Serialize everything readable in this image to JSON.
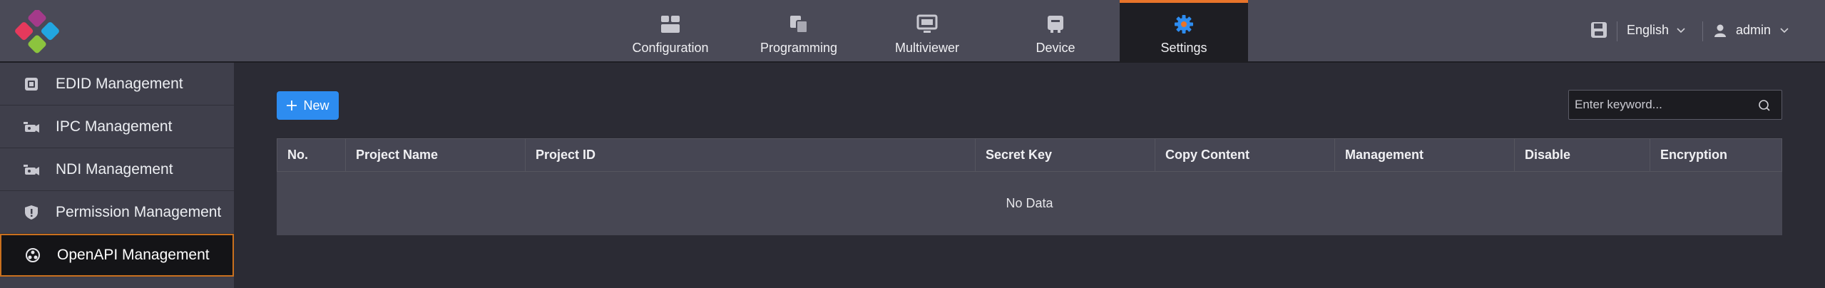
{
  "nav": {
    "tabs": [
      {
        "label": "Configuration",
        "icon": "configuration-icon"
      },
      {
        "label": "Programming",
        "icon": "programming-icon"
      },
      {
        "label": "Multiviewer",
        "icon": "multiviewer-icon"
      },
      {
        "label": "Device",
        "icon": "device-icon"
      },
      {
        "label": "Settings",
        "icon": "settings-gear-icon",
        "active": true
      }
    ]
  },
  "header": {
    "language": "English",
    "user": "admin"
  },
  "sidebar": {
    "items": [
      {
        "label": "EDID Management",
        "icon": "edid-icon"
      },
      {
        "label": "IPC Management",
        "icon": "ipc-camera-icon"
      },
      {
        "label": "NDI Management",
        "icon": "ndi-camera-icon"
      },
      {
        "label": "Permission Management",
        "icon": "shield-icon"
      },
      {
        "label": "OpenAPI Management",
        "icon": "api-icon",
        "active": true
      }
    ]
  },
  "toolbar": {
    "new_label": "New",
    "search_placeholder": "Enter keyword..."
  },
  "table": {
    "columns": [
      "No.",
      "Project Name",
      "Project ID",
      "Secret Key",
      "Copy Content",
      "Management",
      "Disable",
      "Encryption"
    ],
    "empty_text": "No Data"
  },
  "colors": {
    "accent": "#2d8cf0",
    "active_border": "#e8742a",
    "topbar": "#4a4a57",
    "sidebar": "#3f3f4b",
    "background": "#2b2b34"
  }
}
